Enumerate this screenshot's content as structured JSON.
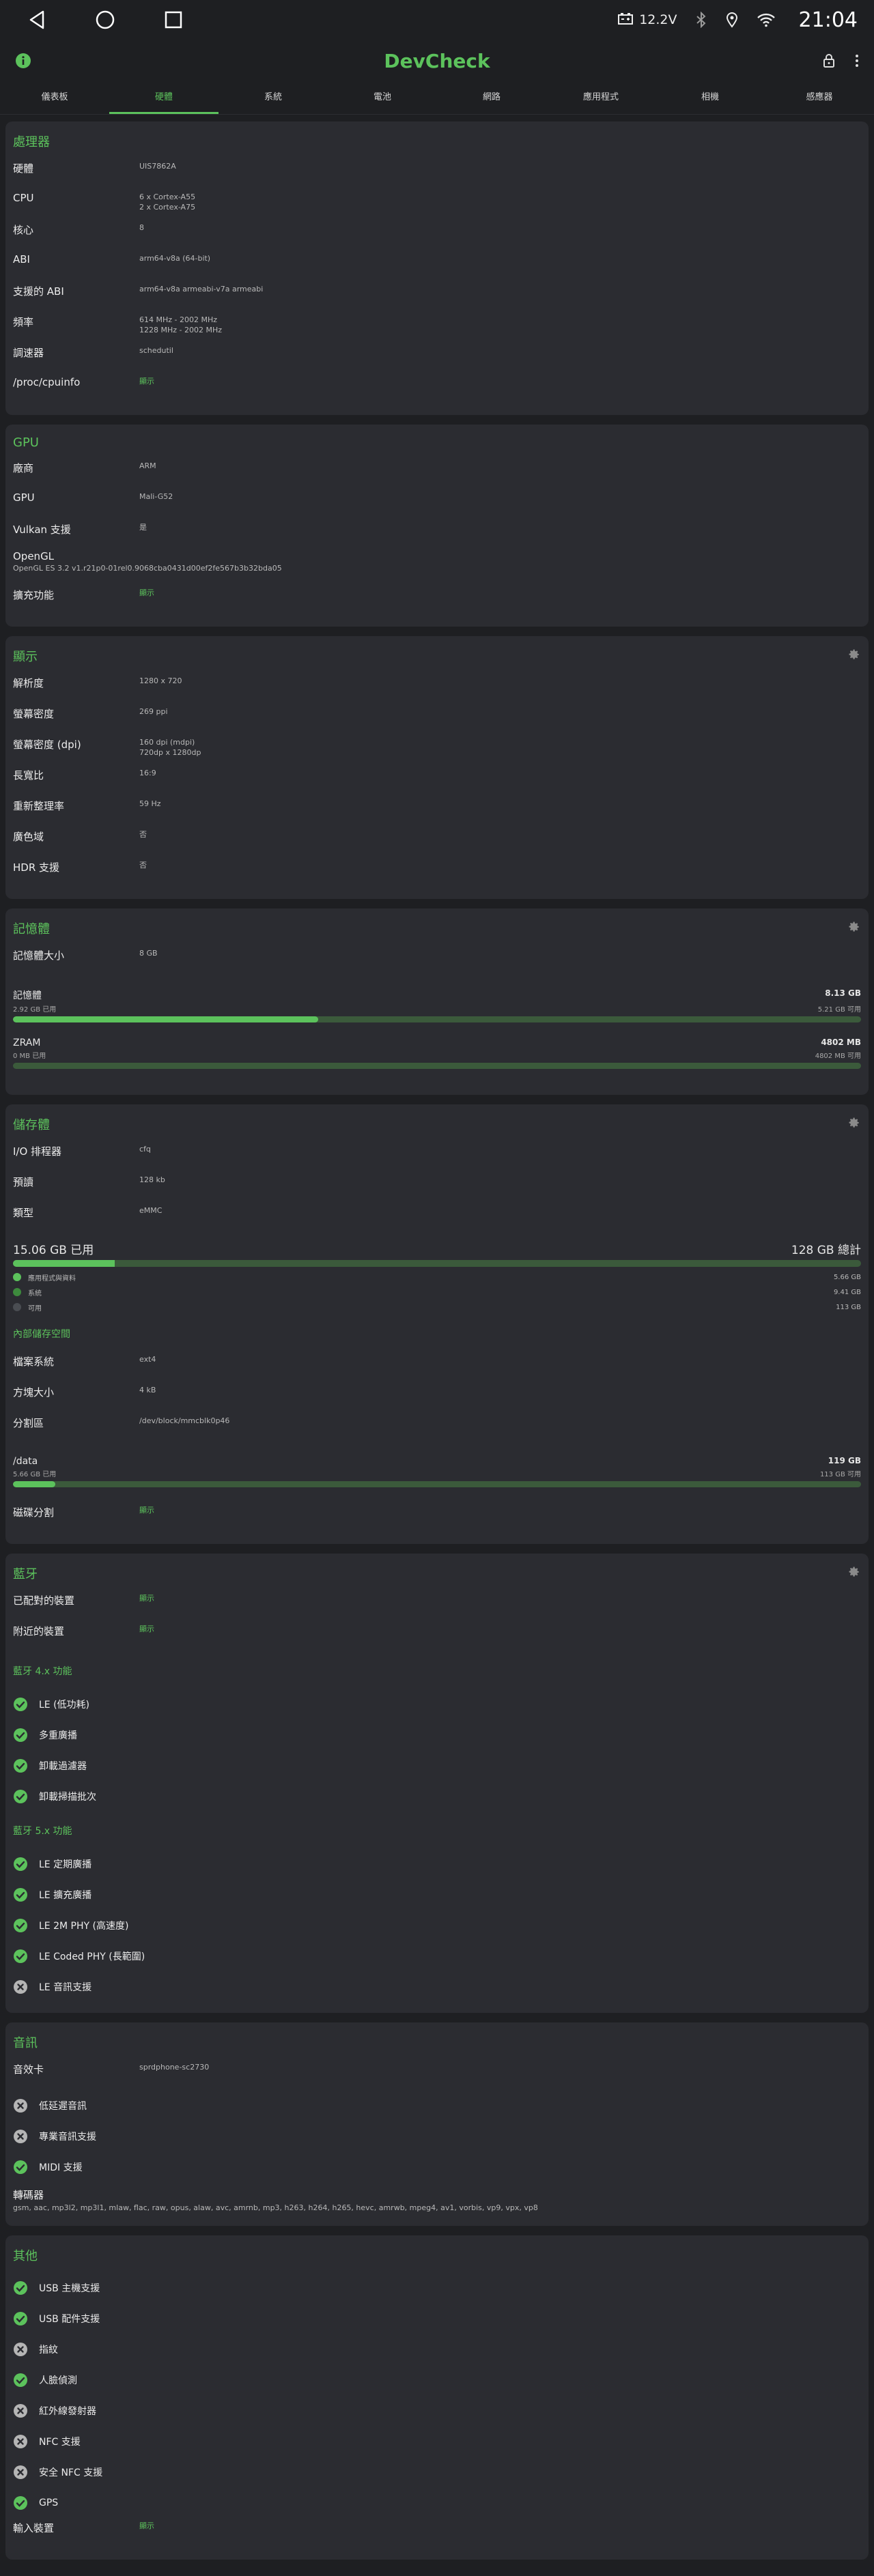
{
  "status_bar": {
    "voltage": "12.2V",
    "time": "21:04"
  },
  "app": {
    "title": "DevCheck"
  },
  "tabs": [
    "儀表板",
    "硬體",
    "系統",
    "電池",
    "網路",
    "應用程式",
    "相機",
    "感應器"
  ],
  "cpu": {
    "title": "處理器",
    "rows": [
      {
        "label": "硬體",
        "value": "UIS7862A"
      },
      {
        "label": "CPU",
        "value": "6 x Cortex-A55\n2 x Cortex-A75"
      },
      {
        "label": "核心",
        "value": "8"
      },
      {
        "label": "ABI",
        "value": "arm64-v8a (64-bit)"
      },
      {
        "label": "支援的 ABI",
        "value": "arm64-v8a armeabi-v7a armeabi"
      },
      {
        "label": "頻率",
        "value": "614 MHz - 2002 MHz\n1228 MHz - 2002 MHz"
      },
      {
        "label": "調速器",
        "value": "schedutil"
      },
      {
        "label": "/proc/cpuinfo",
        "value": "顯示",
        "link": true
      }
    ]
  },
  "gpu": {
    "title": "GPU",
    "rows_a": [
      {
        "label": "廠商",
        "value": "ARM"
      },
      {
        "label": "GPU",
        "value": "Mali-G52"
      },
      {
        "label": "Vulkan 支援",
        "value": "是"
      }
    ],
    "opengl_label": "OpenGL",
    "opengl_value": "OpenGL ES 3.2 v1.r21p0-01rel0.9068cba0431d00ef2fe567b3b32bda05",
    "rows_b": [
      {
        "label": "擴充功能",
        "value": "顯示",
        "link": true
      }
    ]
  },
  "display": {
    "title": "顯示",
    "rows": [
      {
        "label": "解析度",
        "value": "1280 x 720"
      },
      {
        "label": "螢幕密度",
        "value": "269 ppi"
      },
      {
        "label": "螢幕密度 (dpi)",
        "value": "160 dpi (mdpi)\n720dp x 1280dp"
      },
      {
        "label": "長寬比",
        "value": "16:9"
      },
      {
        "label": "重新整理率",
        "value": "59 Hz"
      },
      {
        "label": "廣色域",
        "value": "否"
      },
      {
        "label": "HDR 支援",
        "value": "否"
      }
    ]
  },
  "memory": {
    "title": "記憶體",
    "size_label": "記憶體大小",
    "size_value": "8 GB",
    "meters": [
      {
        "name": "記憶體",
        "total": "8.13 GB",
        "used": "2.92 GB 已用",
        "free": "5.21 GB 可用",
        "fraction": 0.36
      },
      {
        "name": "ZRAM",
        "total": "4802 MB",
        "used": "0 MB 已用",
        "free": "4802 MB 可用",
        "fraction": 0.0
      }
    ]
  },
  "storage": {
    "title": "儲存體",
    "rows": [
      {
        "label": "I/O 排程器",
        "value": "cfq"
      },
      {
        "label": "預讀",
        "value": "128 kb"
      },
      {
        "label": "類型",
        "value": "eMMC"
      }
    ],
    "used": "15.06 GB 已用",
    "total": "128 GB 總計",
    "used_fraction": 0.12,
    "legend": [
      {
        "name": "應用程式與資料",
        "amount": "5.66 GB",
        "color": "#5cc25c"
      },
      {
        "name": "系統",
        "amount": "9.41 GB",
        "color": "#3d8a3d"
      },
      {
        "name": "可用",
        "amount": "113 GB",
        "color": "#4a4d52"
      }
    ],
    "internal_header": "內部儲存空間",
    "internal_rows": [
      {
        "label": "檔案系統",
        "value": "ext4"
      },
      {
        "label": "方塊大小",
        "value": "4 kB"
      },
      {
        "label": "分割區",
        "value": "/dev/block/mmcblk0p46"
      }
    ],
    "data_meter": {
      "name": "/data",
      "total": "119 GB",
      "used": "5.66 GB 已用",
      "free": "113 GB 可用",
      "fraction": 0.05
    },
    "partition_rows": [
      {
        "label": "磁碟分割",
        "value": "顯示",
        "link": true
      }
    ]
  },
  "bluetooth": {
    "title": "藍牙",
    "rows": [
      {
        "label": "已配對的裝置",
        "value": "顯示",
        "link": true
      },
      {
        "label": "附近的裝置",
        "value": "顯示",
        "link": true
      }
    ],
    "bt4_header": "藍牙 4.x 功能",
    "bt4": [
      {
        "name": "LE (低功耗)",
        "ok": true
      },
      {
        "name": "多重廣播",
        "ok": true
      },
      {
        "name": "卸載過濾器",
        "ok": true
      },
      {
        "name": "卸載掃描批次",
        "ok": true
      }
    ],
    "bt5_header": "藍牙 5.x 功能",
    "bt5": [
      {
        "name": "LE 定期廣播",
        "ok": true
      },
      {
        "name": "LE 擴充廣播",
        "ok": true
      },
      {
        "name": "LE 2M PHY (高速度)",
        "ok": true
      },
      {
        "name": "LE Coded PHY (長範圍)",
        "ok": true
      },
      {
        "name": "LE 音訊支援",
        "ok": false
      }
    ]
  },
  "audio": {
    "title": "音訊",
    "rows": [
      {
        "label": "音效卡",
        "value": "sprdphone-sc2730"
      }
    ],
    "features": [
      {
        "name": "低延遲音訊",
        "ok": false
      },
      {
        "name": "專業音訊支援",
        "ok": false
      },
      {
        "name": "MIDI 支援",
        "ok": true
      }
    ],
    "codec_label": "轉碼器",
    "codec_value": "gsm, aac, mp3l2, mp3l1, mlaw, flac, raw, opus, alaw, avc, amrnb, mp3, h263, h264, h265, hevc, amrwb, mpeg4, av1, vorbis, vp9, vpx, vp8"
  },
  "other": {
    "title": "其他",
    "features": [
      {
        "name": "USB 主機支援",
        "ok": true
      },
      {
        "name": "USB 配件支援",
        "ok": true
      },
      {
        "name": "指紋",
        "ok": false
      },
      {
        "name": "人臉偵測",
        "ok": true
      },
      {
        "name": "紅外線發射器",
        "ok": false
      },
      {
        "name": "NFC 支援",
        "ok": false
      },
      {
        "name": "安全 NFC 支援",
        "ok": false
      },
      {
        "name": "GPS",
        "ok": true
      }
    ],
    "rows": [
      {
        "label": "輸入裝置",
        "value": "顯示",
        "link": true
      }
    ]
  },
  "colors": {
    "accent": "#5cc25c",
    "background": "#1e1f22",
    "card": "#2b2c31",
    "cross": "#b5b5b5"
  },
  "icons": {
    "status": [
      "battery-voltage-icon",
      "bluetooth-icon",
      "location-icon",
      "wifi-icon"
    ],
    "nav": [
      "back-icon",
      "home-icon",
      "recents-icon"
    ],
    "card_action": "gear-icon",
    "feature_ok": "check-circle-icon",
    "feature_no": "cross-circle-icon"
  }
}
